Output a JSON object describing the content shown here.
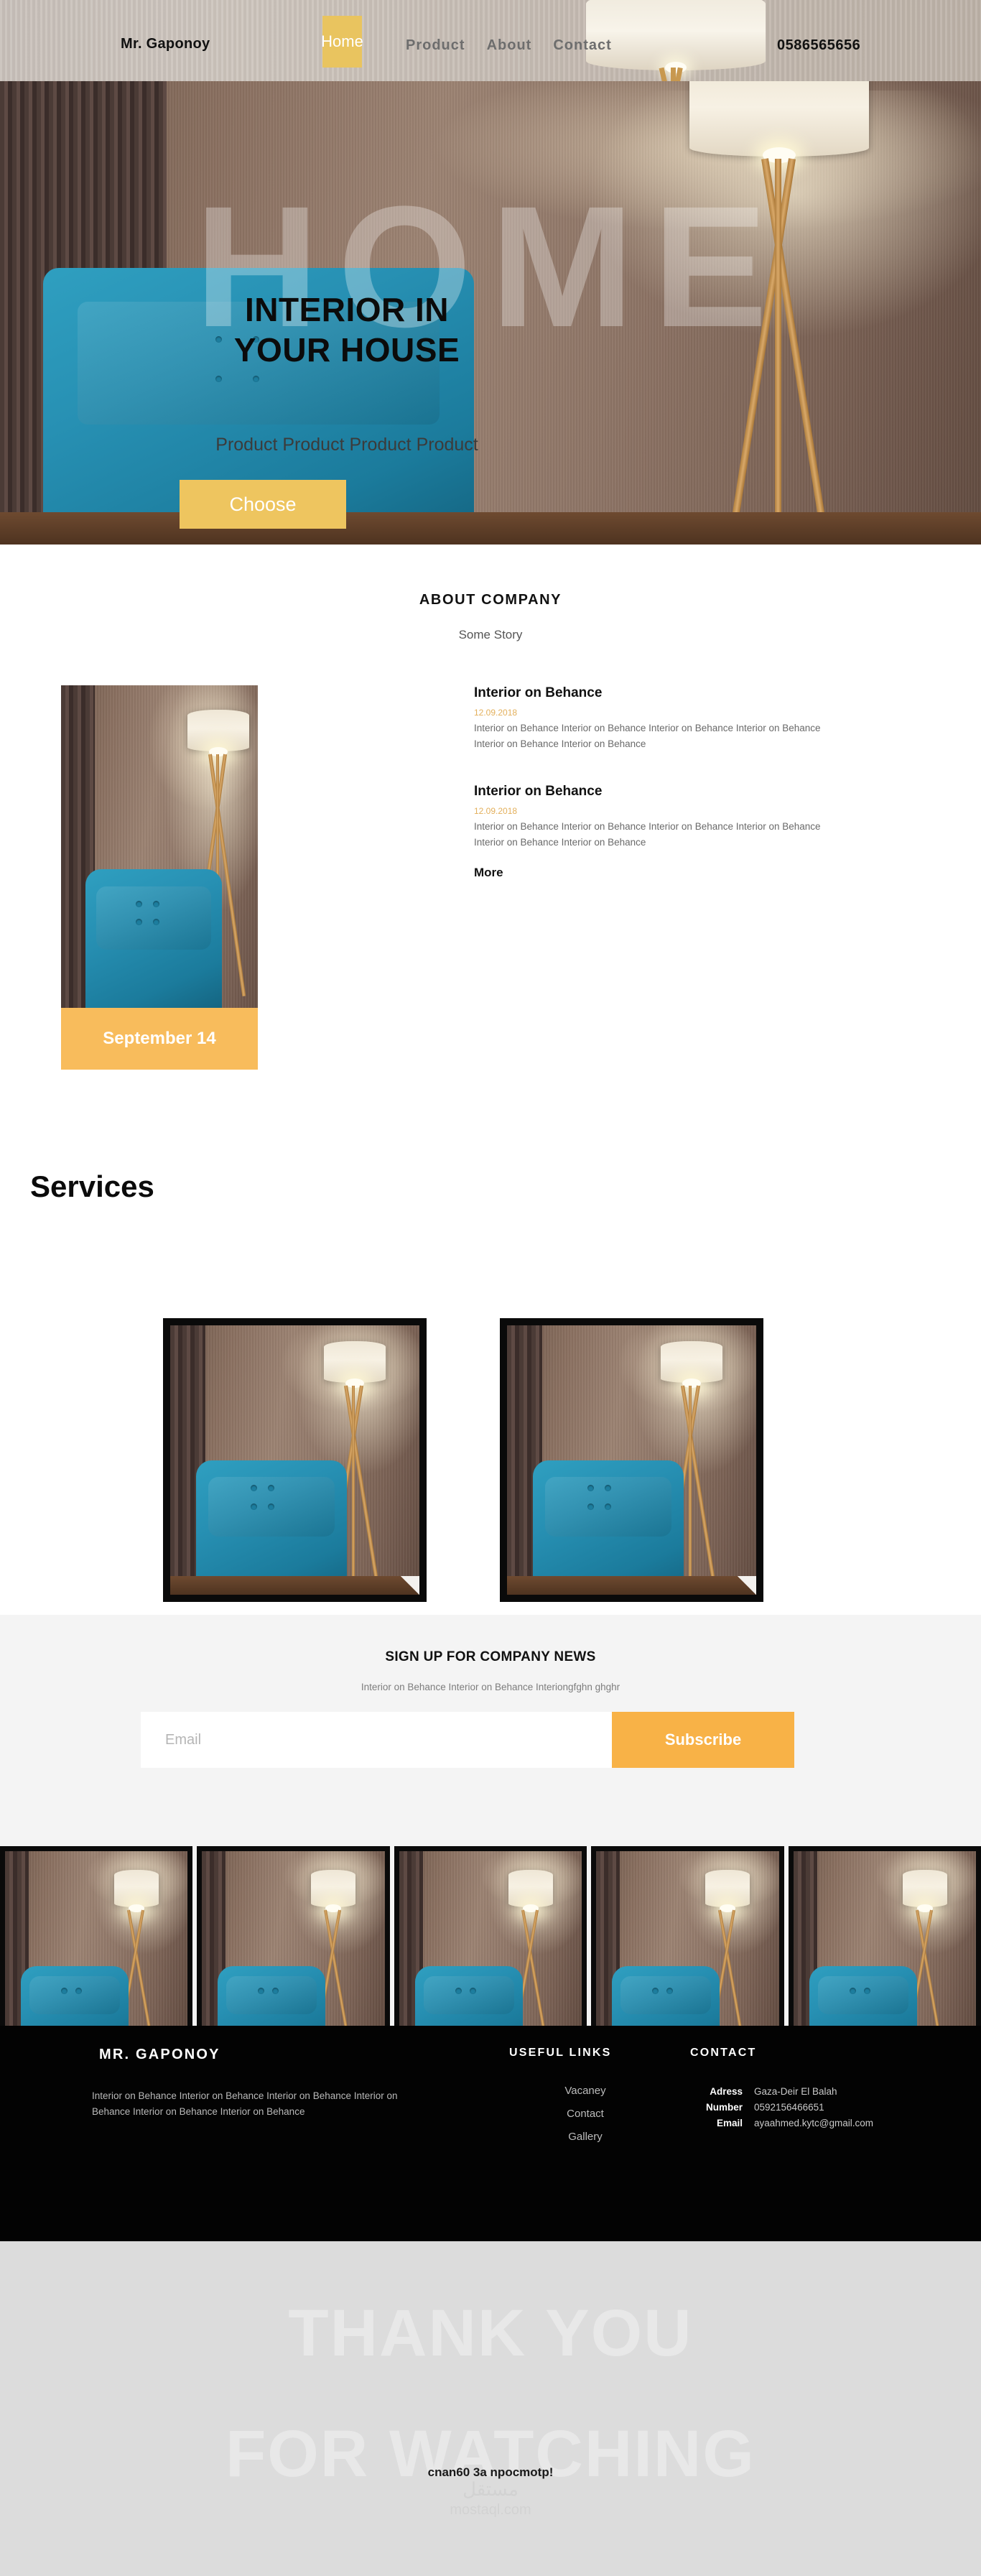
{
  "header": {
    "brand": "Mr. Gaponoy",
    "home_label": "Home",
    "nav": [
      {
        "label": "Product"
      },
      {
        "label": "About"
      },
      {
        "label": "Contact"
      }
    ],
    "phone": "0586565656"
  },
  "hero": {
    "watermark": "HOME",
    "title_line1": "INTERIOR IN",
    "title_line2": "YOUR HOUSE",
    "subtitle": "Product Product Product Product",
    "cta_label": "Choose"
  },
  "about": {
    "title": "ABOUT COMPANY",
    "subtitle": "Some Story",
    "date_badge": "September 14",
    "more_label": "More",
    "articles": [
      {
        "heading": "Interior on Behance",
        "date": "12.09.2018",
        "body": "Interior on Behance Interior on Behance Interior on Behance Interior on Behance Interior on Behance Interior on Behance"
      },
      {
        "heading": "Interior on Behance",
        "date": "12.09.2018",
        "body": "Interior on Behance Interior on Behance Interior on Behance Interior on Behance Interior on Behance Interior on Behance"
      }
    ]
  },
  "services": {
    "title": "Services"
  },
  "newsletter": {
    "title": "SIGN UP FOR COMPANY NEWS",
    "subtitle": "Interior on Behance Interior on Behance Interiongfghn ghghr",
    "email_placeholder": "Email",
    "email_value": "",
    "subscribe_label": "Subscribe"
  },
  "footer": {
    "brand": "MR. GAPONOY",
    "description": "Interior on Behance Interior on Behance Interior on Behance Interior on Behance Interior on Behance Interior on Behance",
    "useful_links_title": "USEFUL LINKS",
    "useful_links": [
      {
        "label": "Vacaney"
      },
      {
        "label": "Contact"
      },
      {
        "label": "Gallery"
      }
    ],
    "contact_title": "CONTACT",
    "contact": [
      {
        "key": "Adress",
        "value": "Gaza-Deir El Balah"
      },
      {
        "key": "Number",
        "value": "0592156466651"
      },
      {
        "key": "Email",
        "value": "ayaahmed.kytc@gmail.com"
      }
    ]
  },
  "thanks": {
    "line1": "THANK YOU",
    "line2": "FOR WATCHING",
    "note": "cnan60 3a npocmotp!",
    "watermark_ar": "مستقل",
    "watermark_en": "mostaql.com"
  },
  "colors": {
    "accent_yellow": "#e9c45f",
    "badge_orange": "#f8bc5c",
    "subscribe_orange": "#f8b247",
    "date_gold": "#e3b05c",
    "footer_black": "#030303",
    "thanks_grey": "#dcdcdc"
  }
}
